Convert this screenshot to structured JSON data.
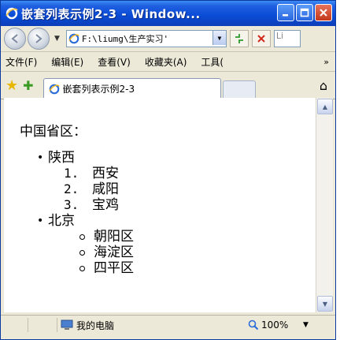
{
  "window": {
    "title": "嵌套列表示例2-3 - Window...",
    "colors": {
      "titlebar": "#0a4bd6",
      "close": "#c2381b",
      "chrome": "#ece9d8"
    }
  },
  "navigation": {
    "address": "F:\\liumg\\生产实习'",
    "search_placeholder": "Li"
  },
  "menu": {
    "items": [
      "文件(F)",
      "编辑(E)",
      "查看(V)",
      "收藏夹(A)",
      "工具("
    ],
    "overflow": "»"
  },
  "tabs": {
    "active_label": "嵌套列表示例2-3"
  },
  "content": {
    "heading": "中国省区：",
    "provinces": [
      {
        "name": "陕西",
        "cities": [
          {
            "num": "1.",
            "name": "西安"
          },
          {
            "num": "2.",
            "name": "咸阳"
          },
          {
            "num": "3.",
            "name": "宝鸡"
          }
        ]
      },
      {
        "name": "北京",
        "districts": [
          "朝阳区",
          "海淀区",
          "四平区"
        ]
      }
    ]
  },
  "status": {
    "zone": "我的电脑",
    "zoom": "100%"
  }
}
